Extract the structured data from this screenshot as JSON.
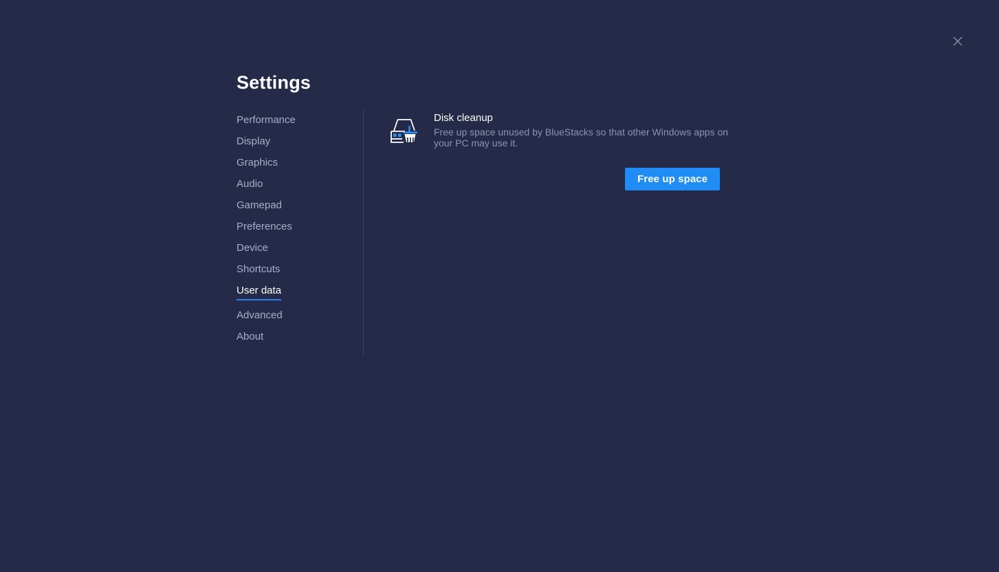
{
  "window": {
    "close_label": "×",
    "background_color": "#242a47"
  },
  "header": {
    "title": "Settings"
  },
  "sidebar": {
    "items": [
      {
        "label": "Performance",
        "active": false
      },
      {
        "label": "Display",
        "active": false
      },
      {
        "label": "Graphics",
        "active": false
      },
      {
        "label": "Audio",
        "active": false
      },
      {
        "label": "Gamepad",
        "active": false
      },
      {
        "label": "Preferences",
        "active": false
      },
      {
        "label": "Device",
        "active": false
      },
      {
        "label": "Shortcuts",
        "active": false
      },
      {
        "label": "User data",
        "active": true
      },
      {
        "label": "Advanced",
        "active": false
      },
      {
        "label": "About",
        "active": false
      }
    ],
    "active_color": "#ffffff",
    "inactive_color": "#a9aec9",
    "underline_color": "#2f7ff0"
  },
  "main": {
    "disk_cleanup": {
      "icon": "disk-cleanup-icon",
      "title": "Disk cleanup",
      "description": "Free up space unused by BlueStacks so that other Windows apps on your PC may use it.",
      "button_label": "Free up space",
      "button_color": "#1f8df5"
    }
  }
}
